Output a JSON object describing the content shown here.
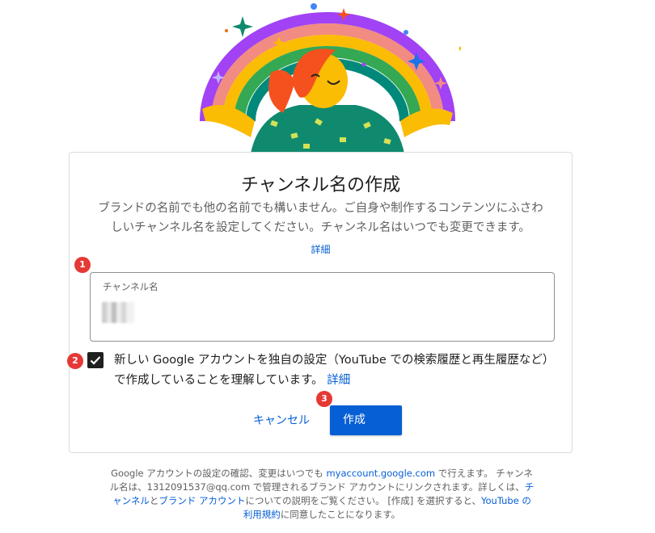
{
  "dialog": {
    "title": "チャンネル名の作成",
    "description": "ブランドの名前でも他の名前でも構いません。ご自身や制作するコンテンツにふさわしいチャンネル名を設定してください。チャンネル名はいつでも変更できます。",
    "details_link": "詳細",
    "channel_field": {
      "label": "チャンネル名",
      "value": "██"
    },
    "checkbox": {
      "checked": true,
      "text": "新しい Google アカウントを独自の設定（YouTube での検索履歴と再生履歴など）で作成していることを理解しています。",
      "link": "詳細"
    },
    "cancel_label": "キャンセル",
    "create_label": "作成"
  },
  "markers": [
    "1",
    "2",
    "3"
  ],
  "footer": {
    "part1": "Google アカウントの設定の確認、変更はいつでも ",
    "link_account": "myaccount.google.com",
    "part2": " で行えます。 チャンネル名は、1312091537@qq.com で管理されるブランド アカウントにリンクされます。詳しくは、",
    "link_channel": "チャンネル",
    "part3": "と",
    "link_brand": "ブランド アカウント",
    "part4": "についての説明をご覧ください。 [作成] を選択すると、",
    "link_terms": "YouTube の利用規約",
    "part5": "に同意したことになります。"
  },
  "colors": {
    "accent": "#065fd4",
    "marker": "#e53935"
  }
}
